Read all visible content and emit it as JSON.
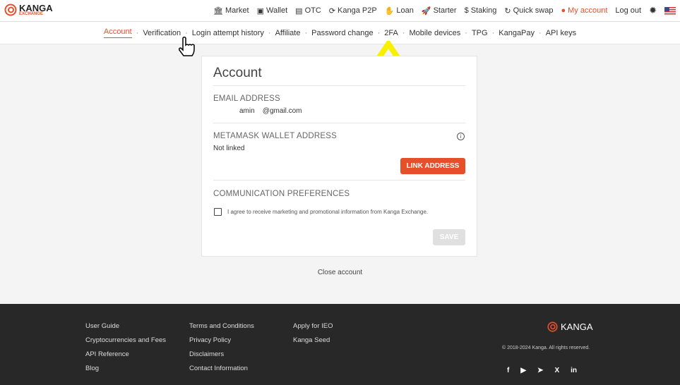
{
  "header": {
    "logo_text": "KANGA",
    "logo_sub": "EXCHANGE",
    "nav": [
      {
        "label": "Market",
        "icon": "bank-icon"
      },
      {
        "label": "Wallet",
        "icon": "wallet-icon"
      },
      {
        "label": "OTC",
        "icon": "otc-icon"
      },
      {
        "label": "Kanga P2P",
        "icon": "p2p-icon"
      },
      {
        "label": "Loan",
        "icon": "loan-icon"
      },
      {
        "label": "Starter",
        "icon": "rocket-icon"
      },
      {
        "label": "Staking",
        "icon": "dollar-icon"
      },
      {
        "label": "Quick swap",
        "icon": "swap-icon"
      },
      {
        "label": "My account",
        "icon": "user-icon"
      },
      {
        "label": "Log out"
      }
    ],
    "accent": "#e5502b"
  },
  "subnav": [
    "Account",
    "Verification",
    "Login attempt history",
    "Affiliate",
    "Password change",
    "2FA",
    "Mobile devices",
    "TPG",
    "KangaPay",
    "API keys"
  ],
  "card": {
    "title": "Account",
    "email_label": "EMAIL ADDRESS",
    "email_value": "amin    @gmail.com",
    "metamask_label": "METAMASK WALLET ADDRESS",
    "metamask_value": "Not linked",
    "link_button": "LINK ADDRESS",
    "comm_label": "COMMUNICATION PREFERENCES",
    "consent": "I agree to receive marketing and promotional information from Kanga Exchange.",
    "consent_checked": false,
    "save_button": "SAVE"
  },
  "close_account": "Close account",
  "footer": {
    "col1": [
      "User Guide",
      "Cryptocurrencies and Fees",
      "API Reference",
      "Blog"
    ],
    "col2": [
      "Terms and Conditions",
      "Privacy Policy",
      "Disclaimers",
      "Contact Information"
    ],
    "col3": [
      "Apply for IEO",
      "Kanga Seed"
    ],
    "brand": "KANGA",
    "copyright": "© 2018-2024 Kanga. All rights reserved.",
    "social": [
      "facebook-icon",
      "youtube-icon",
      "telegram-icon",
      "x-icon",
      "linkedin-icon"
    ]
  }
}
